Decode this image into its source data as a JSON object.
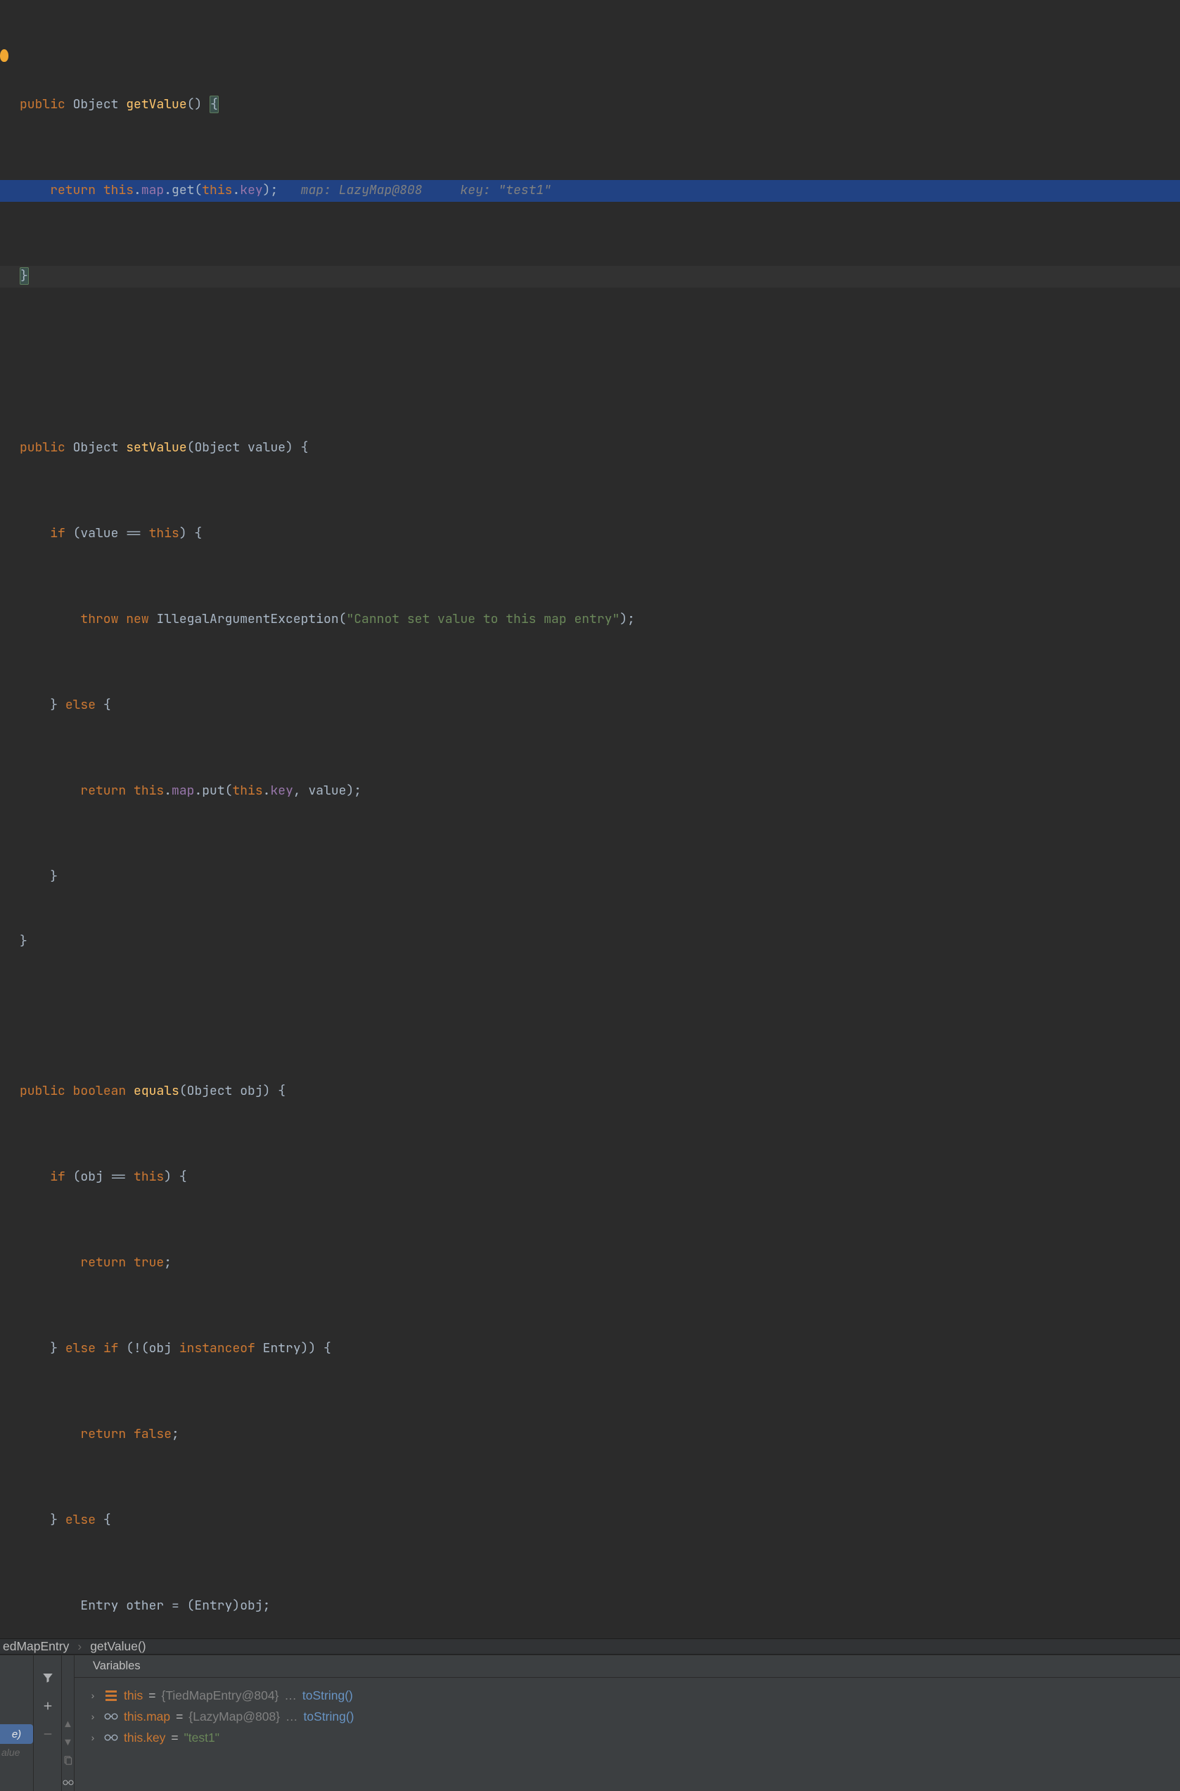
{
  "code": {
    "l1": {
      "kw1": "public",
      "type": "Object",
      "method": "getValue",
      "sig": "() ",
      "brace": "{"
    },
    "l2": {
      "kw": "return ",
      "this1": "this",
      "dot1": ".",
      "f1": "map",
      "dot2": ".",
      "call": "get(",
      "this2": "this",
      "dot3": ".",
      "f2": "key",
      "end": ");",
      "inlay": "   map: LazyMap@808     key: \"test1\""
    },
    "l3": {
      "brace": "}"
    },
    "l5": {
      "kw1": "public",
      "type": "Object",
      "method": "setValue",
      "sig": "(Object value) {"
    },
    "l6": {
      "kw": "if",
      "cond": " (value == ",
      "this": "this",
      "end": ") {"
    },
    "l7": {
      "kw1": "throw",
      "kw2": "new",
      "cls": "IllegalArgumentException",
      "open": "(",
      "str": "\"Cannot set value to this map entry\"",
      "close": ");"
    },
    "l8": {
      "close": "} ",
      "kw": "else",
      "open": " {"
    },
    "l9": {
      "kw": "return ",
      "this1": "this",
      "dot1": ".",
      "f1": "map",
      "dot2": ".",
      "call": "put(",
      "this2": "this",
      "dot3": ".",
      "f2": "key",
      "rest": ", value);"
    },
    "l10": {
      "brace": "}"
    },
    "l11": {
      "brace": "}"
    },
    "l13": {
      "kw1": "public",
      "type": "boolean",
      "method": "equals",
      "sig": "(Object obj) {"
    },
    "l14": {
      "kw": "if",
      "cond": " (obj == ",
      "this": "this",
      "end": ") {"
    },
    "l15": {
      "kw": "return ",
      "val": "true",
      "semi": ";"
    },
    "l16": {
      "close": "} ",
      "kw1": "else",
      "kw2": "if",
      "cond": " (!(obj ",
      "kw3": "instanceof",
      "rest": " Entry)) {"
    },
    "l17": {
      "kw": "return ",
      "val": "false",
      "semi": ";"
    },
    "l18": {
      "close": "} ",
      "kw": "else",
      "open": " {"
    },
    "l19": {
      "txt": "Entry other = (Entry)obj;"
    }
  },
  "breadcrumb": {
    "c1": "edMapEntry",
    "sep": "›",
    "c2": "getValue()"
  },
  "leftstrip": {
    "active": "e)",
    "dim": "alue"
  },
  "vars": {
    "title": "Variables",
    "rows": [
      {
        "icon": "struct",
        "name": "this",
        "eq": " = ",
        "val": "{TiedMapEntry@804} ",
        "dots": "…",
        "link": "toString()"
      },
      {
        "icon": "glasses",
        "name": "this.map",
        "eq": " = ",
        "val": "{LazyMap@808} ",
        "dots": "…",
        "link": "toString()"
      },
      {
        "icon": "glasses",
        "name": "this.key",
        "eq": " = ",
        "str": "\"test1\""
      }
    ]
  }
}
